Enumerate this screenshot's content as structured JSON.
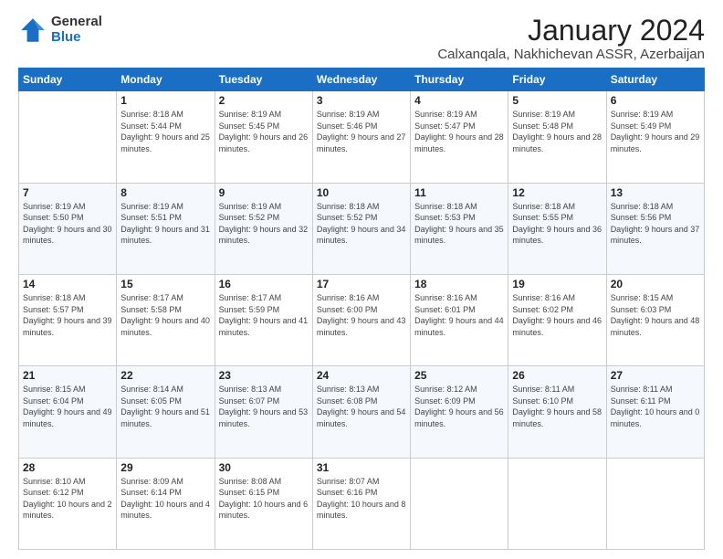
{
  "logo": {
    "general": "General",
    "blue": "Blue"
  },
  "title": "January 2024",
  "subtitle": "Calxanqala, Nakhichevan ASSR, Azerbaijan",
  "days_header": [
    "Sunday",
    "Monday",
    "Tuesday",
    "Wednesday",
    "Thursday",
    "Friday",
    "Saturday"
  ],
  "weeks": [
    [
      {
        "num": "",
        "sunrise": "",
        "sunset": "",
        "daylight": ""
      },
      {
        "num": "1",
        "sunrise": "Sunrise: 8:18 AM",
        "sunset": "Sunset: 5:44 PM",
        "daylight": "Daylight: 9 hours and 25 minutes."
      },
      {
        "num": "2",
        "sunrise": "Sunrise: 8:19 AM",
        "sunset": "Sunset: 5:45 PM",
        "daylight": "Daylight: 9 hours and 26 minutes."
      },
      {
        "num": "3",
        "sunrise": "Sunrise: 8:19 AM",
        "sunset": "Sunset: 5:46 PM",
        "daylight": "Daylight: 9 hours and 27 minutes."
      },
      {
        "num": "4",
        "sunrise": "Sunrise: 8:19 AM",
        "sunset": "Sunset: 5:47 PM",
        "daylight": "Daylight: 9 hours and 28 minutes."
      },
      {
        "num": "5",
        "sunrise": "Sunrise: 8:19 AM",
        "sunset": "Sunset: 5:48 PM",
        "daylight": "Daylight: 9 hours and 28 minutes."
      },
      {
        "num": "6",
        "sunrise": "Sunrise: 8:19 AM",
        "sunset": "Sunset: 5:49 PM",
        "daylight": "Daylight: 9 hours and 29 minutes."
      }
    ],
    [
      {
        "num": "7",
        "sunrise": "Sunrise: 8:19 AM",
        "sunset": "Sunset: 5:50 PM",
        "daylight": "Daylight: 9 hours and 30 minutes."
      },
      {
        "num": "8",
        "sunrise": "Sunrise: 8:19 AM",
        "sunset": "Sunset: 5:51 PM",
        "daylight": "Daylight: 9 hours and 31 minutes."
      },
      {
        "num": "9",
        "sunrise": "Sunrise: 8:19 AM",
        "sunset": "Sunset: 5:52 PM",
        "daylight": "Daylight: 9 hours and 32 minutes."
      },
      {
        "num": "10",
        "sunrise": "Sunrise: 8:18 AM",
        "sunset": "Sunset: 5:52 PM",
        "daylight": "Daylight: 9 hours and 34 minutes."
      },
      {
        "num": "11",
        "sunrise": "Sunrise: 8:18 AM",
        "sunset": "Sunset: 5:53 PM",
        "daylight": "Daylight: 9 hours and 35 minutes."
      },
      {
        "num": "12",
        "sunrise": "Sunrise: 8:18 AM",
        "sunset": "Sunset: 5:55 PM",
        "daylight": "Daylight: 9 hours and 36 minutes."
      },
      {
        "num": "13",
        "sunrise": "Sunrise: 8:18 AM",
        "sunset": "Sunset: 5:56 PM",
        "daylight": "Daylight: 9 hours and 37 minutes."
      }
    ],
    [
      {
        "num": "14",
        "sunrise": "Sunrise: 8:18 AM",
        "sunset": "Sunset: 5:57 PM",
        "daylight": "Daylight: 9 hours and 39 minutes."
      },
      {
        "num": "15",
        "sunrise": "Sunrise: 8:17 AM",
        "sunset": "Sunset: 5:58 PM",
        "daylight": "Daylight: 9 hours and 40 minutes."
      },
      {
        "num": "16",
        "sunrise": "Sunrise: 8:17 AM",
        "sunset": "Sunset: 5:59 PM",
        "daylight": "Daylight: 9 hours and 41 minutes."
      },
      {
        "num": "17",
        "sunrise": "Sunrise: 8:16 AM",
        "sunset": "Sunset: 6:00 PM",
        "daylight": "Daylight: 9 hours and 43 minutes."
      },
      {
        "num": "18",
        "sunrise": "Sunrise: 8:16 AM",
        "sunset": "Sunset: 6:01 PM",
        "daylight": "Daylight: 9 hours and 44 minutes."
      },
      {
        "num": "19",
        "sunrise": "Sunrise: 8:16 AM",
        "sunset": "Sunset: 6:02 PM",
        "daylight": "Daylight: 9 hours and 46 minutes."
      },
      {
        "num": "20",
        "sunrise": "Sunrise: 8:15 AM",
        "sunset": "Sunset: 6:03 PM",
        "daylight": "Daylight: 9 hours and 48 minutes."
      }
    ],
    [
      {
        "num": "21",
        "sunrise": "Sunrise: 8:15 AM",
        "sunset": "Sunset: 6:04 PM",
        "daylight": "Daylight: 9 hours and 49 minutes."
      },
      {
        "num": "22",
        "sunrise": "Sunrise: 8:14 AM",
        "sunset": "Sunset: 6:05 PM",
        "daylight": "Daylight: 9 hours and 51 minutes."
      },
      {
        "num": "23",
        "sunrise": "Sunrise: 8:13 AM",
        "sunset": "Sunset: 6:07 PM",
        "daylight": "Daylight: 9 hours and 53 minutes."
      },
      {
        "num": "24",
        "sunrise": "Sunrise: 8:13 AM",
        "sunset": "Sunset: 6:08 PM",
        "daylight": "Daylight: 9 hours and 54 minutes."
      },
      {
        "num": "25",
        "sunrise": "Sunrise: 8:12 AM",
        "sunset": "Sunset: 6:09 PM",
        "daylight": "Daylight: 9 hours and 56 minutes."
      },
      {
        "num": "26",
        "sunrise": "Sunrise: 8:11 AM",
        "sunset": "Sunset: 6:10 PM",
        "daylight": "Daylight: 9 hours and 58 minutes."
      },
      {
        "num": "27",
        "sunrise": "Sunrise: 8:11 AM",
        "sunset": "Sunset: 6:11 PM",
        "daylight": "Daylight: 10 hours and 0 minutes."
      }
    ],
    [
      {
        "num": "28",
        "sunrise": "Sunrise: 8:10 AM",
        "sunset": "Sunset: 6:12 PM",
        "daylight": "Daylight: 10 hours and 2 minutes."
      },
      {
        "num": "29",
        "sunrise": "Sunrise: 8:09 AM",
        "sunset": "Sunset: 6:14 PM",
        "daylight": "Daylight: 10 hours and 4 minutes."
      },
      {
        "num": "30",
        "sunrise": "Sunrise: 8:08 AM",
        "sunset": "Sunset: 6:15 PM",
        "daylight": "Daylight: 10 hours and 6 minutes."
      },
      {
        "num": "31",
        "sunrise": "Sunrise: 8:07 AM",
        "sunset": "Sunset: 6:16 PM",
        "daylight": "Daylight: 10 hours and 8 minutes."
      },
      {
        "num": "",
        "sunrise": "",
        "sunset": "",
        "daylight": ""
      },
      {
        "num": "",
        "sunrise": "",
        "sunset": "",
        "daylight": ""
      },
      {
        "num": "",
        "sunrise": "",
        "sunset": "",
        "daylight": ""
      }
    ]
  ]
}
